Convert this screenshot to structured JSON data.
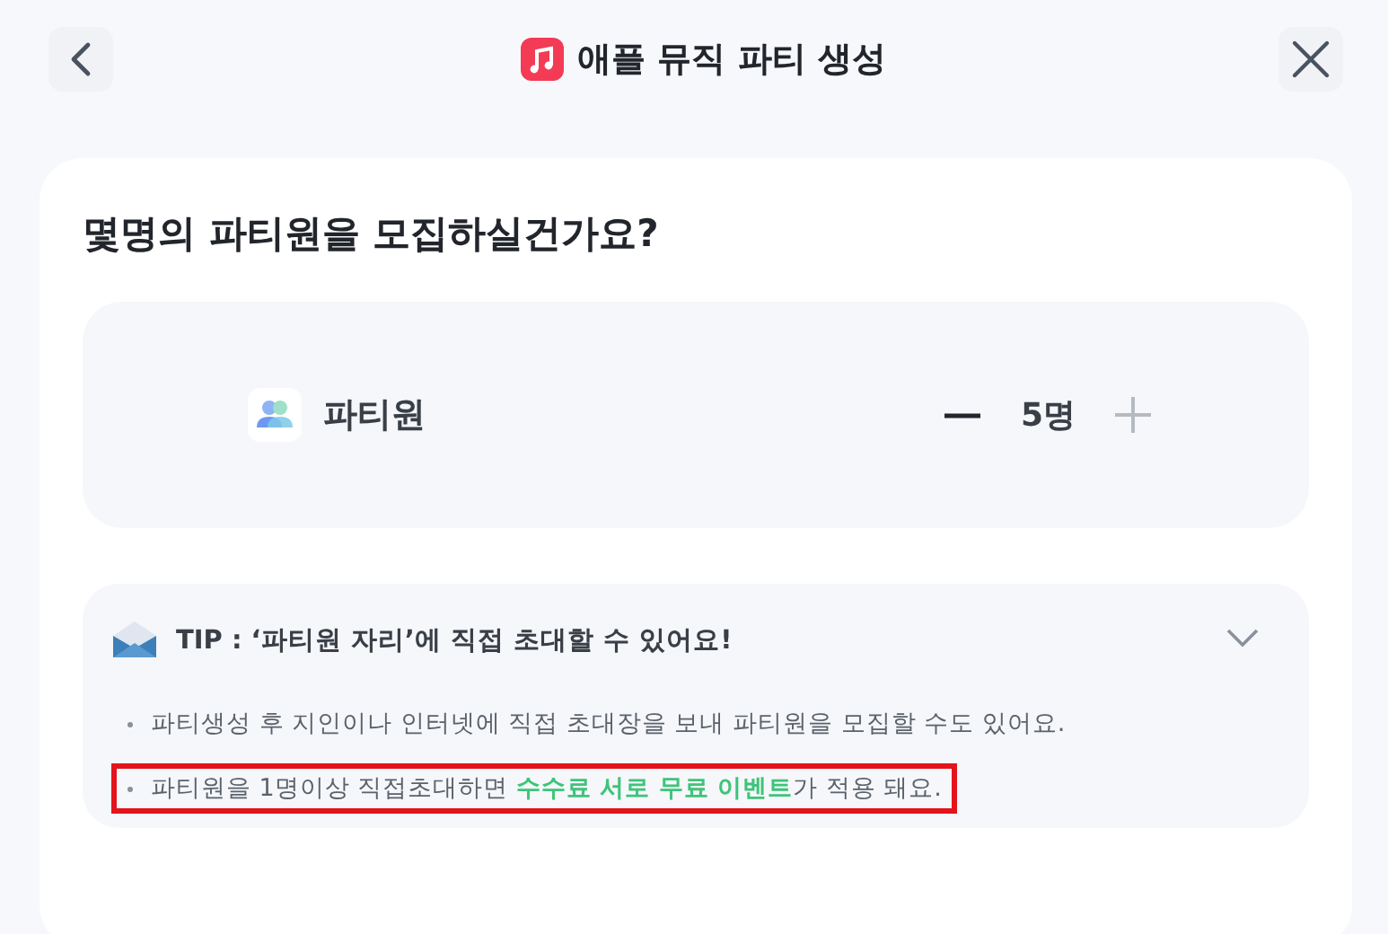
{
  "header": {
    "title": "애플 뮤직 파티 생성"
  },
  "question": "몇명의 파티원을 모집하실건가요?",
  "counter": {
    "label": "파티원",
    "value": "5명",
    "decrease_disabled": false,
    "increase_disabled": true
  },
  "tip": {
    "title": "TIP : ‘파티원 자리’에 직접 초대할 수 있어요!",
    "expanded": true,
    "items": [
      {
        "highlighted": false,
        "segments": [
          {
            "text": "파티생성 후 지인이나 인터넷에 직접 초대장을 보내 파티원을 모집할 수도 있어요.",
            "emphasis": false
          }
        ]
      },
      {
        "highlighted": true,
        "segments": [
          {
            "text": "파티원을 1명이상 직접초대하면 ",
            "emphasis": false
          },
          {
            "text": "수수료 서로 무료 이벤트",
            "emphasis": true
          },
          {
            "text": "가 적용 돼요.",
            "emphasis": false
          }
        ]
      }
    ]
  }
}
